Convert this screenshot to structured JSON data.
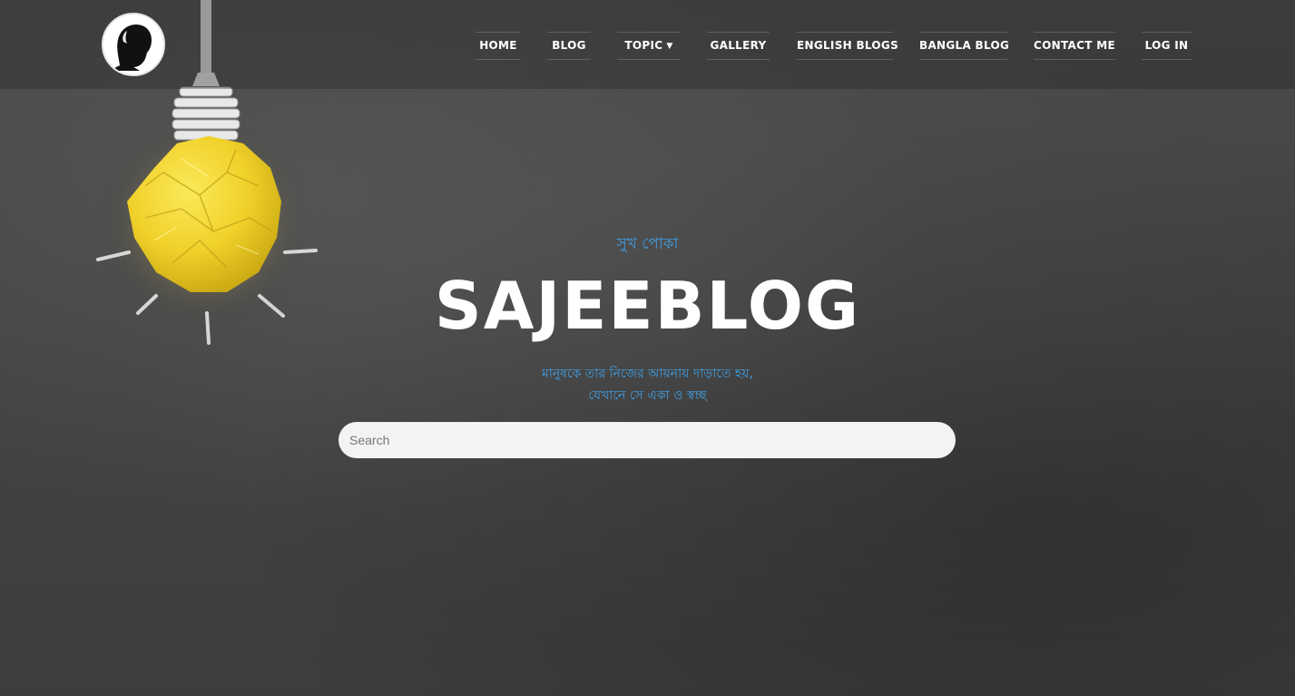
{
  "header": {
    "logo_icon": "avatar-silhouette-icon",
    "nav": [
      {
        "label": "HOME"
      },
      {
        "label": "BLOG"
      },
      {
        "label": "TOPIC",
        "has_dropdown": true
      },
      {
        "label": "GALLERY"
      },
      {
        "label": "ENGLISH BLOGS"
      },
      {
        "label": "BANGLA BLOG"
      },
      {
        "label": "CONTACT ME"
      },
      {
        "label": "LOG IN"
      }
    ]
  },
  "hero": {
    "tagline": "সুখ পোকা",
    "title": "SAJEEBLOG",
    "quote_line1": "মানুষকে তার নিজের আয়নায় দাড়াতে হয়,",
    "quote_line2": "যেখানে সে একা ও স্বচ্ছ"
  },
  "search": {
    "placeholder": "Search",
    "value": ""
  },
  "colors": {
    "accent": "#3f9fe6",
    "title": "#ffffff",
    "background": "#474747",
    "bulb": "#f0d12a"
  }
}
